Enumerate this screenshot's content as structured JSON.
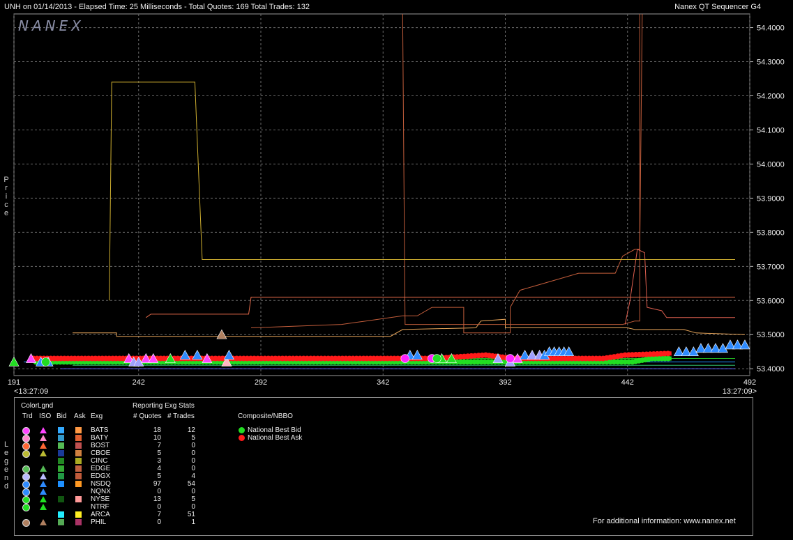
{
  "header": {
    "title": "UNH on 01/14/2013  -  Elapsed Time: 25 Milliseconds  -  Total Quotes: 169  Total Trades: 132",
    "app": "Nanex QT Sequencer G4"
  },
  "logo_text": "NANEX",
  "side_labels": {
    "price": "Price",
    "legend": "Legend"
  },
  "chart_data": {
    "type": "line",
    "xlim": [
      191,
      492
    ],
    "ylim": [
      53.38,
      54.44
    ],
    "x_ticks": [
      "191",
      "242",
      "292",
      "342",
      "392",
      "442",
      "492"
    ],
    "y_ticks": [
      "53.4000",
      "53.5000",
      "53.6000",
      "53.7000",
      "53.8000",
      "53.9000",
      "54.0000",
      "54.1000",
      "54.2000",
      "54.3000",
      "54.4000"
    ],
    "x_start_time": "<13:27:09",
    "x_end_time": "13:27:09>",
    "grid": true,
    "series": [
      {
        "name": "BATS",
        "color": "#e9a65a",
        "points": [
          [
            215,
            53.505
          ],
          [
            233,
            53.505
          ],
          [
            233,
            53.495
          ],
          [
            345,
            53.495
          ],
          [
            350,
            53.515
          ],
          [
            380,
            53.52
          ],
          [
            382,
            53.54
          ],
          [
            392,
            53.545
          ],
          [
            392,
            53.52
          ],
          [
            442,
            53.52
          ],
          [
            445,
            53.515
          ],
          [
            465,
            53.515
          ],
          [
            470,
            53.505
          ],
          [
            490,
            53.5
          ]
        ]
      },
      {
        "name": "EDGX",
        "color": "#c25d3b",
        "points": [
          [
            288,
            53.52
          ],
          [
            325,
            53.53
          ],
          [
            335,
            53.54
          ],
          [
            350,
            53.555
          ],
          [
            356,
            53.555
          ],
          [
            362,
            53.58
          ],
          [
            375,
            53.58
          ],
          [
            375,
            53.505
          ],
          [
            394,
            53.505
          ],
          [
            394,
            53.58
          ],
          [
            398,
            53.63
          ],
          [
            422,
            53.68
          ],
          [
            437,
            53.68
          ],
          [
            440,
            53.73
          ],
          [
            445,
            53.75
          ],
          [
            447,
            53.75
          ],
          [
            448,
            54.44
          ]
        ]
      },
      {
        "name": "BOST",
        "color": "#c25d3b",
        "points": [
          [
            350,
            54.44
          ],
          [
            351,
            53.53
          ],
          [
            440,
            53.53
          ],
          [
            445,
            53.54
          ],
          [
            447,
            53.54
          ],
          [
            447,
            54.44
          ]
        ]
      },
      {
        "name": "NYSE",
        "color": "#e36a4a",
        "points": [
          [
            245,
            53.55
          ],
          [
            247,
            53.56
          ],
          [
            287,
            53.56
          ],
          [
            288,
            53.61
          ],
          [
            486,
            53.61
          ]
        ]
      },
      {
        "name": "CBOE",
        "color": "#e06050",
        "points": [
          [
            441,
            53.53
          ],
          [
            443,
            53.6
          ],
          [
            446,
            53.75
          ],
          [
            449,
            53.74
          ],
          [
            450,
            53.58
          ],
          [
            456,
            53.57
          ],
          [
            458,
            53.55
          ],
          [
            486,
            53.55
          ]
        ]
      },
      {
        "name": "PHIL",
        "color": "#d0b030",
        "points": [
          [
            230,
            53.6
          ],
          [
            231,
            54.24
          ],
          [
            265,
            54.24
          ],
          [
            268,
            53.72
          ],
          [
            486,
            53.72
          ]
        ]
      },
      {
        "name": "CINC",
        "color": "#6060ff",
        "points": [
          [
            210,
            53.4
          ],
          [
            486,
            53.4
          ]
        ]
      },
      {
        "name": "ARCA",
        "color": "#30c070",
        "points": [
          [
            215,
            53.41
          ],
          [
            486,
            53.41
          ]
        ]
      },
      {
        "name": "NQNX",
        "color": "#1e90ff",
        "points": [
          [
            195,
            53.42
          ],
          [
            486,
            53.42
          ]
        ]
      },
      {
        "name": "NTRF",
        "color": "#20b020",
        "points": [
          [
            210,
            53.43
          ],
          [
            486,
            53.43
          ]
        ]
      },
      {
        "name": "National Best Bid",
        "color": "#22dd22",
        "marker": "circle",
        "points": [
          [
            200,
            53.42
          ],
          [
            274,
            53.42
          ],
          [
            295,
            53.42
          ],
          [
            348,
            53.42
          ],
          [
            395,
            53.42
          ],
          [
            432,
            53.42
          ],
          [
            444,
            53.42
          ],
          [
            452,
            53.43
          ],
          [
            460,
            53.43
          ]
        ]
      },
      {
        "name": "National Best Ask",
        "color": "#ff1a1a",
        "marker": "circle",
        "points": [
          [
            199,
            53.43
          ],
          [
            237,
            53.43
          ],
          [
            272,
            53.43
          ],
          [
            334,
            53.43
          ],
          [
            362,
            53.43
          ],
          [
            384,
            53.44
          ],
          [
            395,
            53.43
          ],
          [
            432,
            53.43
          ],
          [
            441,
            53.44
          ],
          [
            460,
            53.445
          ]
        ]
      }
    ],
    "trades": [
      {
        "x": 191,
        "y": 53.42,
        "color": "#22dd22"
      },
      {
        "x": 198,
        "y": 53.43,
        "color": "#ff44ff"
      },
      {
        "x": 202,
        "y": 53.42,
        "color": "#2e8bff"
      },
      {
        "x": 205,
        "y": 53.42,
        "color": "#2e8bff"
      },
      {
        "x": 238,
        "y": 53.43,
        "color": "#ff44ff"
      },
      {
        "x": 240,
        "y": 53.42,
        "color": "#a0a0ff"
      },
      {
        "x": 242,
        "y": 53.42,
        "color": "#a0a0ff"
      },
      {
        "x": 245,
        "y": 53.43,
        "color": "#ff44ff"
      },
      {
        "x": 248,
        "y": 53.43,
        "color": "#ff44ff"
      },
      {
        "x": 255,
        "y": 53.43,
        "color": "#22dd22"
      },
      {
        "x": 261,
        "y": 53.44,
        "color": "#2e8bff"
      },
      {
        "x": 266,
        "y": 53.44,
        "color": "#2e8bff"
      },
      {
        "x": 270,
        "y": 53.43,
        "color": "#ff44ff"
      },
      {
        "x": 276,
        "y": 53.5,
        "color": "#b08060"
      },
      {
        "x": 278,
        "y": 53.42,
        "color": "#ffb6c1"
      },
      {
        "x": 279,
        "y": 53.44,
        "color": "#2e8bff"
      },
      {
        "x": 353,
        "y": 53.44,
        "color": "#2e8bff"
      },
      {
        "x": 356,
        "y": 53.44,
        "color": "#2e8bff"
      },
      {
        "x": 366,
        "y": 53.43,
        "color": "#22dd22"
      },
      {
        "x": 370,
        "y": 53.43,
        "color": "#22dd22"
      },
      {
        "x": 389,
        "y": 53.43,
        "color": "#a0a0ff"
      },
      {
        "x": 394,
        "y": 53.42,
        "color": "#a0a0ff"
      },
      {
        "x": 397,
        "y": 53.43,
        "color": "#ff44ff"
      },
      {
        "x": 400,
        "y": 53.44,
        "color": "#2e8bff"
      },
      {
        "x": 403,
        "y": 53.44,
        "color": "#a0a0ff"
      },
      {
        "x": 406,
        "y": 53.44,
        "color": "#a0a0ff"
      },
      {
        "x": 408,
        "y": 53.44,
        "color": "#2e8bff"
      },
      {
        "x": 410,
        "y": 53.45,
        "color": "#2e8bff"
      },
      {
        "x": 412,
        "y": 53.45,
        "color": "#2e8bff"
      },
      {
        "x": 414,
        "y": 53.45,
        "color": "#2e8bff"
      },
      {
        "x": 416,
        "y": 53.45,
        "color": "#2e8bff"
      },
      {
        "x": 418,
        "y": 53.45,
        "color": "#2e8bff"
      },
      {
        "x": 463,
        "y": 53.45,
        "color": "#2e8bff"
      },
      {
        "x": 466,
        "y": 53.45,
        "color": "#2e8bff"
      },
      {
        "x": 469,
        "y": 53.45,
        "color": "#2e8bff"
      },
      {
        "x": 472,
        "y": 53.46,
        "color": "#2e8bff"
      },
      {
        "x": 475,
        "y": 53.46,
        "color": "#2e8bff"
      },
      {
        "x": 478,
        "y": 53.46,
        "color": "#2e8bff"
      },
      {
        "x": 481,
        "y": 53.46,
        "color": "#2e8bff"
      },
      {
        "x": 484,
        "y": 53.47,
        "color": "#2e8bff"
      },
      {
        "x": 487,
        "y": 53.47,
        "color": "#2e8bff"
      },
      {
        "x": 490,
        "y": 53.47,
        "color": "#2e8bff"
      }
    ],
    "circle_trades": [
      {
        "x": 204,
        "y": 53.42,
        "color": "#22dd22"
      },
      {
        "x": 351,
        "y": 53.43,
        "color": "#ff22ff"
      },
      {
        "x": 362,
        "y": 53.43,
        "color": "#ff22ff"
      },
      {
        "x": 364,
        "y": 53.43,
        "color": "#22dd22"
      },
      {
        "x": 394,
        "y": 53.43,
        "color": "#ff22ff"
      }
    ]
  },
  "legend": {
    "title_colorlgnd": "ColorLgnd",
    "col_headers": [
      "Trd",
      "ISO",
      "Bid",
      "Ask",
      "Exg"
    ],
    "stats_title": "Reporting Exg Stats",
    "stats_headers": [
      "# Quotes",
      "# Trades"
    ],
    "rows": [
      {
        "exg": "BATS",
        "quotes": "18",
        "trades": "12",
        "trd": "#ff44ff",
        "iso": "#ff44ff",
        "bid": "#33aaff",
        "ask": "#ff9944"
      },
      {
        "exg": "BATY",
        "quotes": "10",
        "trades": "5",
        "trd": "#ff88cc",
        "iso": "#ff88cc",
        "bid": "#3399cc",
        "ask": "#e06030"
      },
      {
        "exg": "BOST",
        "quotes": "7",
        "trades": "0",
        "trd": "#ff6633",
        "iso": "#ff6633",
        "bid": "#55bb55",
        "ask": "#c05050"
      },
      {
        "exg": "CBOE",
        "quotes": "5",
        "trades": "0",
        "trd": "#bbbb33",
        "iso": "#bbbb33",
        "bid": "#1a3a99",
        "ask": "#d08040"
      },
      {
        "exg": "CINC",
        "quotes": "3",
        "trades": "0",
        "trd": "",
        "iso": "",
        "bid": "#228822",
        "ask": "#aaaa22"
      },
      {
        "exg": "EDGE",
        "quotes": "4",
        "trades": "0",
        "trd": "#55bb55",
        "iso": "#55bb55",
        "bid": "#33aa33",
        "ask": "#c06040"
      },
      {
        "exg": "EDGX",
        "quotes": "5",
        "trades": "4",
        "trd": "#bbbbff",
        "iso": "#bbbbff",
        "bid": "#229944",
        "ask": "#c05a3a"
      },
      {
        "exg": "NSDQ",
        "quotes": "97",
        "trades": "54",
        "trd": "#2e8bff",
        "iso": "#2e8bff",
        "bid": "#1e90ff",
        "ask": "#ff9922"
      },
      {
        "exg": "NQNX",
        "quotes": "0",
        "trades": "0",
        "trd": "#2e8bff",
        "iso": "#2e8bff",
        "bid": "",
        "ask": ""
      },
      {
        "exg": "NYSE",
        "quotes": "13",
        "trades": "5",
        "trd": "#22dd22",
        "iso": "#22dd22",
        "bid": "#115511",
        "ask": "#ff9999"
      },
      {
        "exg": "NTRF",
        "quotes": "0",
        "trades": "0",
        "trd": "#22dd22",
        "iso": "#22dd22",
        "bid": "",
        "ask": ""
      },
      {
        "exg": "ARCA",
        "quotes": "7",
        "trades": "51",
        "trd": "",
        "iso": "",
        "bid": "#22eeff",
        "ask": "#ffee22"
      },
      {
        "exg": "PHIL",
        "quotes": "0",
        "trades": "1",
        "trd": "#b08060",
        "iso": "#b08060",
        "bid": "#55aa55",
        "ask": "#aa3366"
      }
    ],
    "composite_title": "Composite/NBBO",
    "composite": [
      {
        "label": "National Best Bid",
        "color": "#22dd22"
      },
      {
        "label": "National Best Ask",
        "color": "#ff1a1a"
      }
    ],
    "footer": "For additional information: www.nanex.net"
  }
}
